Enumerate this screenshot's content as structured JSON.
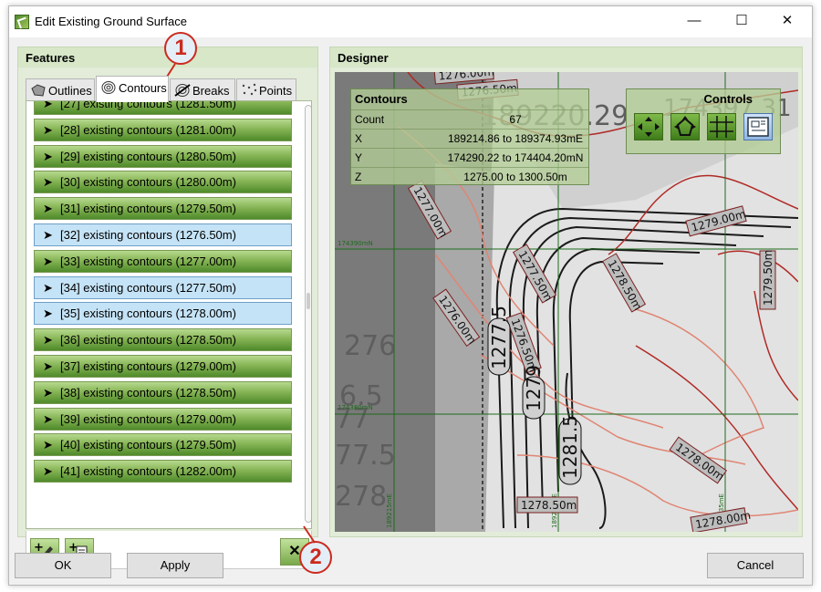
{
  "window": {
    "title": "Edit Existing Ground Surface",
    "minimize_glyph": "—",
    "maximize_glyph": "☐",
    "close_glyph": "✕"
  },
  "features": {
    "header": "Features",
    "tabs": [
      {
        "label": "Outlines",
        "icon": "outline-shape-icon"
      },
      {
        "label": "Contours",
        "icon": "contours-icon",
        "active": true
      },
      {
        "label": "Breaks",
        "icon": "breaklines-icon"
      },
      {
        "label": "Points",
        "icon": "points-icon"
      }
    ],
    "items": [
      {
        "label": "[27] existing contours (1281.50m)",
        "selected": false
      },
      {
        "label": "[28] existing contours (1281.00m)",
        "selected": false
      },
      {
        "label": "[29] existing contours (1280.50m)",
        "selected": false
      },
      {
        "label": "[30] existing contours (1280.00m)",
        "selected": false
      },
      {
        "label": "[31] existing contours (1279.50m)",
        "selected": false
      },
      {
        "label": "[32] existing contours (1276.50m)",
        "selected": true
      },
      {
        "label": "[33] existing contours (1277.00m)",
        "selected": false
      },
      {
        "label": "[34] existing contours (1277.50m)",
        "selected": true
      },
      {
        "label": "[35] existing contours (1278.00m)",
        "selected": true
      },
      {
        "label": "[36] existing contours (1278.50m)",
        "selected": false
      },
      {
        "label": "[37] existing contours (1279.00m)",
        "selected": false
      },
      {
        "label": "[38] existing contours (1278.50m)",
        "selected": false
      },
      {
        "label": "[39] existing contours (1279.00m)",
        "selected": false
      },
      {
        "label": "[40] existing contours (1279.50m)",
        "selected": false
      },
      {
        "label": "[41] existing contours (1282.00m)",
        "selected": false
      }
    ],
    "tools": {
      "add_drawn_icon": "add-pencil-icon",
      "add_file_icon": "add-document-icon",
      "delete_icon": "delete-x-icon",
      "delete_glyph": "✕"
    }
  },
  "designer": {
    "header": "Designer",
    "contours_info": {
      "title": "Contours",
      "rows": [
        {
          "key": "Count",
          "value": "67"
        },
        {
          "key": "X",
          "value": "189214.86 to 189374.93mE"
        },
        {
          "key": "Y",
          "value": "174290.22 to 174404.20mN"
        },
        {
          "key": "Z",
          "value": "1275.00 to 1300.50m"
        }
      ]
    },
    "controls": {
      "title": "Controls",
      "buttons": [
        "pan-arrows-icon",
        "rotate-view-icon",
        "grid-icon",
        "layout-preview-icon"
      ]
    },
    "map_labels": [
      "1276.00m",
      "1276.50m",
      "1277.00m",
      "1277.50m",
      "1278.00m",
      "1278.50m",
      "1279.00m",
      "1279.50m",
      "1276.00m",
      "1276.50m",
      "1278.50m",
      "1278.00m",
      "1277.5",
      "1279",
      "1281.5"
    ],
    "background_labels": [
      "189220.29",
      "276",
      "6.5",
      "77.5",
      "278",
      "174397.31"
    ],
    "grid_labels": [
      "174390mN",
      "174380mN",
      "189215mE",
      "189225mE",
      "189235mE"
    ]
  },
  "footer": {
    "ok": "OK",
    "apply": "Apply",
    "cancel": "Cancel"
  },
  "callouts": [
    "1",
    "2"
  ],
  "colors": {
    "contour_red": "#c8372d",
    "contour_salmon": "#e68a76",
    "grid_green": "#1e6b1e",
    "item_green": "#6f9f3e"
  }
}
